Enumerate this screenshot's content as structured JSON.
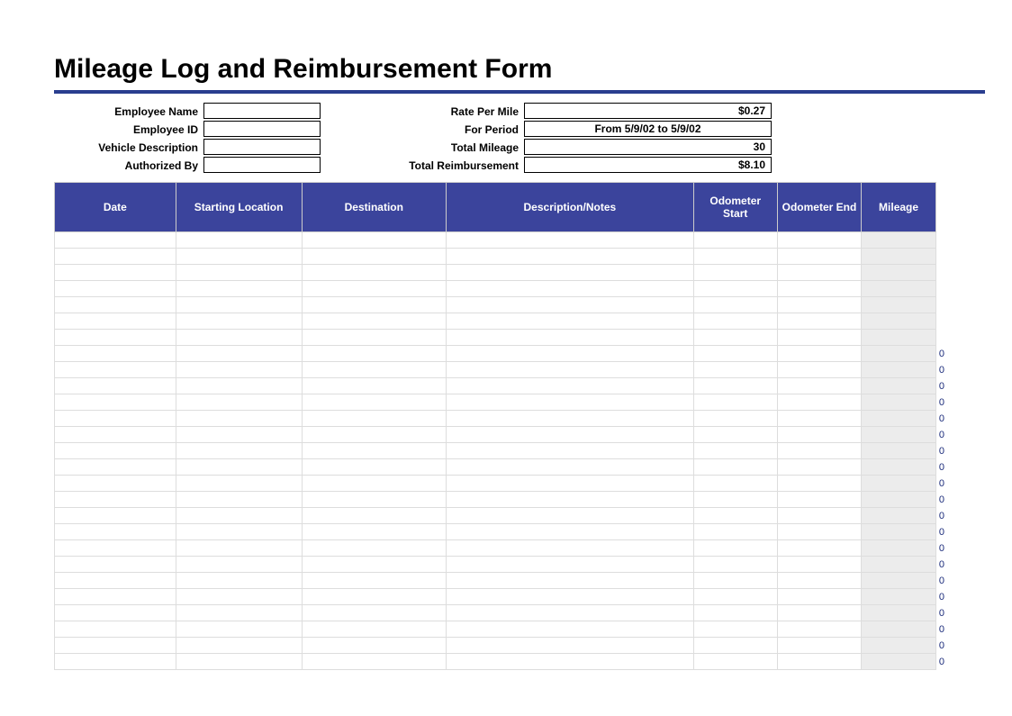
{
  "title": "Mileage Log and Reimbursement Form",
  "header": {
    "left": [
      {
        "label": "Employee Name",
        "value": ""
      },
      {
        "label": "Employee ID",
        "value": ""
      },
      {
        "label": "Vehicle Description",
        "value": ""
      },
      {
        "label": "Authorized By",
        "value": ""
      }
    ],
    "right": [
      {
        "label": "Rate Per Mile",
        "value": "$0.27",
        "align": "right"
      },
      {
        "label": "For Period",
        "value": "From 5/9/02 to 5/9/02",
        "align": "center"
      },
      {
        "label": "Total Mileage",
        "value": "30",
        "align": "right"
      },
      {
        "label": "Total Reimbursement",
        "value": "$8.10",
        "align": "right"
      }
    ]
  },
  "columns": [
    "Date",
    "Starting Location",
    "Destination",
    "Description/Notes",
    "Odometer Start",
    "Odometer End",
    "Mileage"
  ],
  "rows": [
    {
      "mileage": "",
      "overflow": ""
    },
    {
      "mileage": "",
      "overflow": ""
    },
    {
      "mileage": "",
      "overflow": ""
    },
    {
      "mileage": "",
      "overflow": ""
    },
    {
      "mileage": "",
      "overflow": ""
    },
    {
      "mileage": "",
      "overflow": ""
    },
    {
      "mileage": "",
      "overflow": ""
    },
    {
      "mileage": "",
      "overflow": "0"
    },
    {
      "mileage": "",
      "overflow": "0"
    },
    {
      "mileage": "",
      "overflow": "0"
    },
    {
      "mileage": "",
      "overflow": "0"
    },
    {
      "mileage": "",
      "overflow": "0"
    },
    {
      "mileage": "",
      "overflow": "0"
    },
    {
      "mileage": "",
      "overflow": "0"
    },
    {
      "mileage": "",
      "overflow": "0"
    },
    {
      "mileage": "",
      "overflow": "0"
    },
    {
      "mileage": "",
      "overflow": "0"
    },
    {
      "mileage": "",
      "overflow": "0"
    },
    {
      "mileage": "",
      "overflow": "0"
    },
    {
      "mileage": "",
      "overflow": "0"
    },
    {
      "mileage": "",
      "overflow": "0"
    },
    {
      "mileage": "",
      "overflow": "0"
    },
    {
      "mileage": "",
      "overflow": "0"
    },
    {
      "mileage": "",
      "overflow": "0"
    },
    {
      "mileage": "",
      "overflow": "0"
    },
    {
      "mileage": "",
      "overflow": "0"
    },
    {
      "mileage": "",
      "overflow": "0"
    }
  ]
}
